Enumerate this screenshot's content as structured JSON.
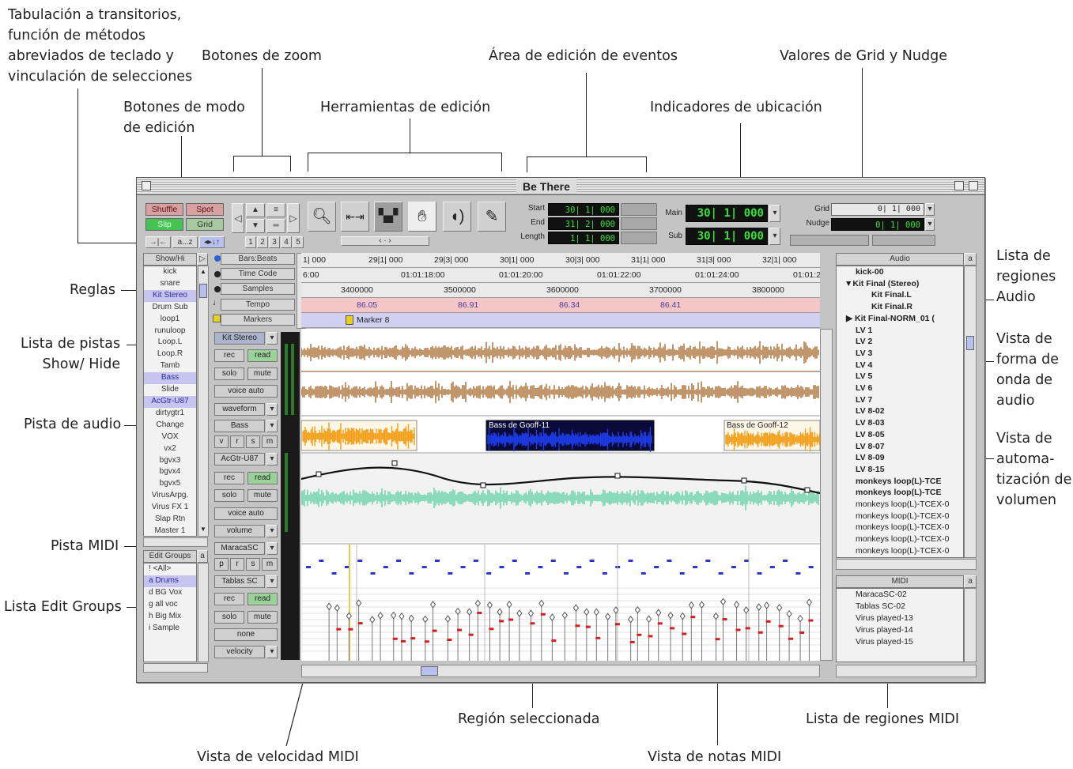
{
  "callouts": {
    "tab_transients": [
      "Tabulación a transitorios,",
      "función de métodos",
      "abreviados de teclado y",
      "vinculación de selecciones"
    ],
    "zoom_buttons": "Botones de zoom",
    "event_edit_area": "Área de edición de eventos",
    "grid_nudge_values": "Valores de Grid y Nudge",
    "edit_mode_buttons": [
      "Botones de modo",
      "de edición"
    ],
    "edit_tools": "Herramientas de edición",
    "location_indicators": "Indicadores de ubicación",
    "audio_regions_list": [
      "Lista de",
      "regiones",
      "Audio"
    ],
    "rulers": "Reglas",
    "tracks_list": [
      "Lista de pistas",
      "Show/ Hide"
    ],
    "waveform_view": [
      "Vista de",
      "forma de",
      "onda de",
      "audio"
    ],
    "audio_track": "Pista de audio",
    "volume_automation_view": [
      "Vista de",
      "automa-",
      "tización de",
      "volumen"
    ],
    "midi_track": "Pista MIDI",
    "edit_groups_list": "Lista Edit Groups",
    "selected_region": "Región seleccionada",
    "midi_regions_list": "Lista de regiones MIDI",
    "midi_velocity_view": "Vista de velocidad MIDI",
    "midi_notes_view": "Vista de notas MIDI"
  },
  "window": {
    "title": "Be There",
    "modes": {
      "shuffle": "Shuffle",
      "spot": "Spot",
      "slip": "Slip",
      "grid": "Grid"
    },
    "shortcut_buttons": [
      "→|←",
      "a...z",
      "◂▸↓↑"
    ],
    "zoom_presets": [
      "1",
      "2",
      "3",
      "4",
      "5"
    ],
    "counters": {
      "start_label": "Start",
      "start": "30| 1| 000",
      "end_label": "End",
      "end": "31| 2| 000",
      "length_label": "Length",
      "length": "1| 1| 000",
      "main_label": "Main",
      "main": "30| 1| 000",
      "sub_label": "Sub",
      "sub": "30| 1| 000",
      "grid_label": "Grid",
      "grid": "0| 1| 000",
      "nudge_label": "Nudge",
      "nudge": "0| 1| 000"
    },
    "show_hide_header": "Show/Hi",
    "tracks": [
      "kick",
      "snare",
      "Kit Stereo",
      "Drum Sub",
      "loop1",
      "runuloop",
      "Loop.L",
      "Loop.R",
      "Tamb",
      "Bass",
      "Slide",
      "AcGtr-U87",
      "dirtygtr1",
      "Change",
      "VOX",
      "vx2",
      "bgvx3",
      "bgvx4",
      "bgvx5",
      "VirusArpg.",
      "Virus FX 1",
      "Slap Rtn",
      "Master 1"
    ],
    "edit_groups_header": "Edit Groups",
    "edit_groups": [
      "! <All>",
      "a Drums",
      "d BG Vox",
      "g all voc",
      "h Big Mix",
      "i Sample"
    ],
    "rulers": {
      "bars_beats": "Bars:Beats",
      "time_code": "Time Code",
      "samples": "Samples",
      "tempo": "Tempo",
      "markers": "Markers",
      "bars_values": [
        "1| 000",
        "29|1| 000",
        "29|3| 000",
        "30|1| 000",
        "30|3| 000",
        "31|1| 000",
        "31|3| 000",
        "32|1| 000"
      ],
      "timecode_values": [
        "6:00",
        "01:01:18:00",
        "01:01:20:00",
        "01:01:22:00",
        "01:01:24:00",
        "01:01:26:00"
      ],
      "samples_values": [
        "3400000",
        "3500000",
        "3600000",
        "3700000",
        "3800000"
      ],
      "tempo_values": [
        "86.05",
        "86.91",
        "86.34",
        "86.41"
      ],
      "marker_label": "Marker 8"
    },
    "track_controls": {
      "kit_stereo": {
        "name": "Kit Stereo",
        "rec": "rec",
        "read": "read",
        "solo": "solo",
        "mute": "mute",
        "voice": "voice auto",
        "view": "waveform"
      },
      "bass": {
        "name": "Bass",
        "vrsm": [
          "v",
          "r",
          "s",
          "m"
        ]
      },
      "acgtr": {
        "name": "AcGtr-U87",
        "rec": "rec",
        "read": "read",
        "solo": "solo",
        "mute": "mute",
        "voice": "voice auto",
        "view": "volume"
      },
      "maraca": {
        "name": "MaracaSC",
        "prsm": [
          "p",
          "r",
          "s",
          "m"
        ]
      },
      "tablas": {
        "name": "Tablas SC",
        "rec": "rec",
        "read": "read",
        "solo": "solo",
        "mute": "mute",
        "voice": "none",
        "view": "velocity"
      }
    },
    "regions": {
      "bass_left": "",
      "bass_selected": "Bass de Gooff-11",
      "bass_right": "Bass de Gooff-12"
    },
    "audio_list_header": "Audio",
    "audio_regions": [
      "kick-00",
      "▼Kit Final (Stereo)",
      "Kit Final.L",
      "Kit Final.R",
      "▶ Kit Final-NORM_01 (",
      "LV 1",
      "LV 2",
      "LV 3",
      "LV 4",
      "LV 5",
      "LV 6",
      "LV 7",
      "LV 8-02",
      "LV 8-03",
      "LV 8-05",
      "LV 8-07",
      "LV 8-09",
      "LV 8-15",
      "monkeys loop(L)-TCE",
      "monkeys loop(L)-TCE",
      "monkeys loop(L)-TCEX-0",
      "monkeys loop(L)-TCEX-0",
      "monkeys loop(L)-TCEX-0",
      "monkeys loop(L)-TCEX-0",
      "monkeys loop(L)-TCEX-0"
    ],
    "midi_list_header": "MIDI",
    "midi_regions": [
      "MaracaSC-02",
      "Tablas SC-02",
      "Virus played-13",
      "Virus played-14",
      "Virus played-15"
    ]
  },
  "colors": {
    "counter_green": "#37e23b",
    "tempo_bg": "#f5c6c6",
    "marker_bg": "#d2d0f2",
    "waveform_brown": "#a86a2e",
    "bass_orange": "#f2a01b",
    "selection_blue": "#1e3be8",
    "automation_green": "#5fd0a6",
    "midi_note_blue": "#2c36c8",
    "velocity_red": "#d22020"
  }
}
